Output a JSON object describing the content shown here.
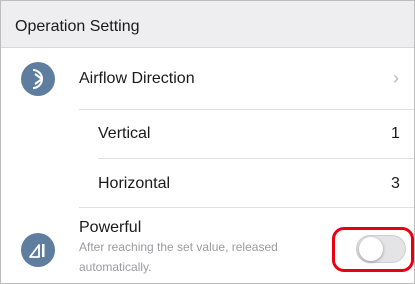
{
  "header": {
    "title": "Operation Setting"
  },
  "airflow": {
    "icon": "airflow-direction-icon",
    "label": "Airflow Direction",
    "chevron": "›",
    "vertical": {
      "label": "Vertical",
      "value": "1"
    },
    "horizontal": {
      "label": "Horizontal",
      "value": "3"
    }
  },
  "powerful": {
    "icon": "powerful-mode-icon",
    "label": "Powerful",
    "description": "After reaching the set value, released automatically.",
    "toggle_on": false
  },
  "colors": {
    "icon_bg": "#5e7d9f",
    "highlight": "#e60012",
    "header_bg": "#eeeef0"
  }
}
